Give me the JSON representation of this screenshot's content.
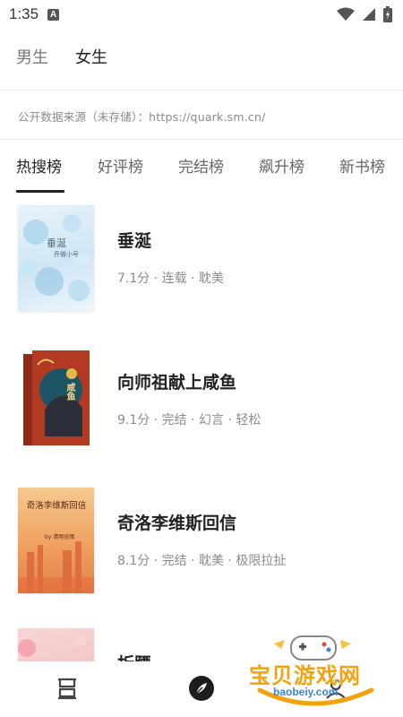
{
  "status_bar": {
    "time": "1:35",
    "notification_icon": "A"
  },
  "gender_tabs": [
    {
      "label": "男生",
      "active": false
    },
    {
      "label": "女生",
      "active": true
    }
  ],
  "source_note": "公开数据来源（未存储）：https://quark.sm.cn/",
  "rank_tabs": [
    {
      "label": "热搜榜",
      "active": true
    },
    {
      "label": "好评榜",
      "active": false
    },
    {
      "label": "完结榜",
      "active": false
    },
    {
      "label": "飙升榜",
      "active": false
    },
    {
      "label": "新书榜",
      "active": false
    }
  ],
  "books": [
    {
      "title": "垂涎",
      "meta": "7.1分 · 连载 · 耽美",
      "cover_text": "垂涎",
      "cover_author": "乔微小号"
    },
    {
      "title": "向师祖献上咸鱼",
      "meta": "9.1分 · 完结 · 幻言 · 轻松",
      "cover_text": "咸鱼"
    },
    {
      "title": "奇洛李维斯回信",
      "meta": "8.1分 · 完结 · 耽美 · 极限拉扯",
      "cover_text": "奇洛李维斯回信",
      "cover_author": "by 清明谷雨"
    },
    {
      "title": "折腰",
      "meta": ""
    }
  ],
  "bottom_nav": [
    {
      "icon": "bookshelf-icon"
    },
    {
      "icon": "compass-icon"
    },
    {
      "icon": "profile-icon"
    }
  ],
  "watermark": {
    "text": "宝贝游戏网",
    "url": "baobeiy.com"
  },
  "colors": {
    "accent": "#222222",
    "muted": "#8c8c8c",
    "watermark_orange": "#f2a20f",
    "watermark_blue": "#3b87d8"
  }
}
